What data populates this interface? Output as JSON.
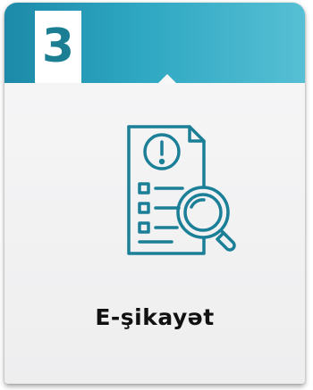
{
  "card": {
    "number": "3",
    "title": "E-şikayət",
    "icon": "complaint-search-document-icon",
    "colors": {
      "accent": "#1c8aa8",
      "accent_light": "#56bfd4",
      "number_color": "#1b7e93",
      "icon_stroke": "#1a7f97",
      "background": "#f4f4f5"
    }
  }
}
